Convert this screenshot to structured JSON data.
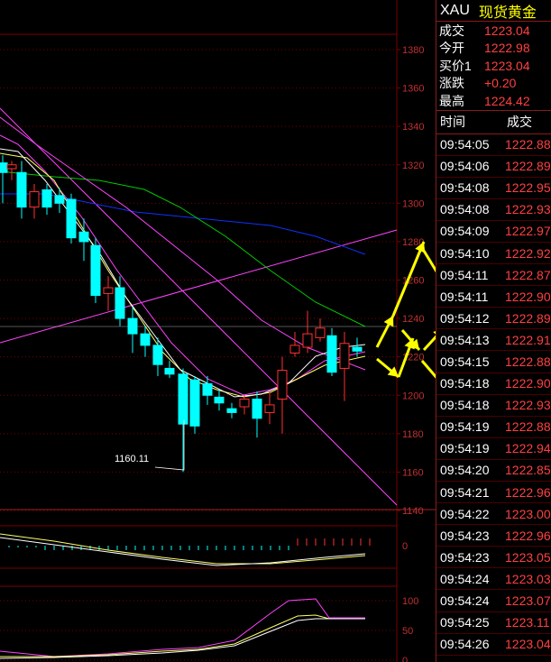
{
  "chart": {
    "price_ticks": [
      "1380",
      "1360",
      "1340",
      "1320",
      "1300",
      "1280",
      "1260",
      "1240",
      "1220",
      "1200",
      "1180",
      "1160",
      "1140"
    ],
    "low_marker": "1160.11",
    "indicator1_ticks": [
      "0"
    ],
    "indicator2_ticks": [
      "100",
      "50",
      "0"
    ],
    "colors": {
      "up": "#ff3030",
      "down": "#00ffff",
      "ma_short": "#ffff66",
      "ma_mid": "#ff44ff",
      "ma_long": "#00cc00",
      "ma_200": "#1030ff",
      "grid": "#7a0000",
      "arrow": "#ffff00"
    }
  },
  "panel": {
    "symbol": "XAU",
    "name": "现货黄金",
    "quote": [
      {
        "label": "成交",
        "value": "1223.04"
      },
      {
        "label": "今开",
        "value": "1222.98"
      },
      {
        "label": "买价1",
        "value": "1223.04"
      },
      {
        "label": "涨跌",
        "value": "+0.20"
      },
      {
        "label": "最高",
        "value": "1224.42"
      }
    ],
    "ticks_header": {
      "time": "时间",
      "price": "成交"
    },
    "ticks": [
      {
        "time": "09:54:05",
        "price": "1222.88"
      },
      {
        "time": "09:54:06",
        "price": "1222.89"
      },
      {
        "time": "09:54:08",
        "price": "1222.95"
      },
      {
        "time": "09:54:08",
        "price": "1222.93"
      },
      {
        "time": "09:54:09",
        "price": "1222.97"
      },
      {
        "time": "09:54:10",
        "price": "1222.92"
      },
      {
        "time": "09:54:11",
        "price": "1222.87"
      },
      {
        "time": "09:54:11",
        "price": "1222.90"
      },
      {
        "time": "09:54:12",
        "price": "1222.89"
      },
      {
        "time": "09:54:13",
        "price": "1222.91"
      },
      {
        "time": "09:54:15",
        "price": "1222.88"
      },
      {
        "time": "09:54:18",
        "price": "1222.90"
      },
      {
        "time": "09:54:18",
        "price": "1222.93"
      },
      {
        "time": "09:54:19",
        "price": "1222.88"
      },
      {
        "time": "09:54:19",
        "price": "1222.94"
      },
      {
        "time": "09:54:20",
        "price": "1222.85"
      },
      {
        "time": "09:54:21",
        "price": "1222.96"
      },
      {
        "time": "09:54:22",
        "price": "1223.00"
      },
      {
        "time": "09:54:23",
        "price": "1222.96"
      },
      {
        "time": "09:54:23",
        "price": "1223.05"
      },
      {
        "time": "09:54:24",
        "price": "1223.03"
      },
      {
        "time": "09:54:24",
        "price": "1223.07"
      },
      {
        "time": "09:54:25",
        "price": "1223.11"
      },
      {
        "time": "09:54:26",
        "price": "1223.04"
      }
    ]
  }
}
